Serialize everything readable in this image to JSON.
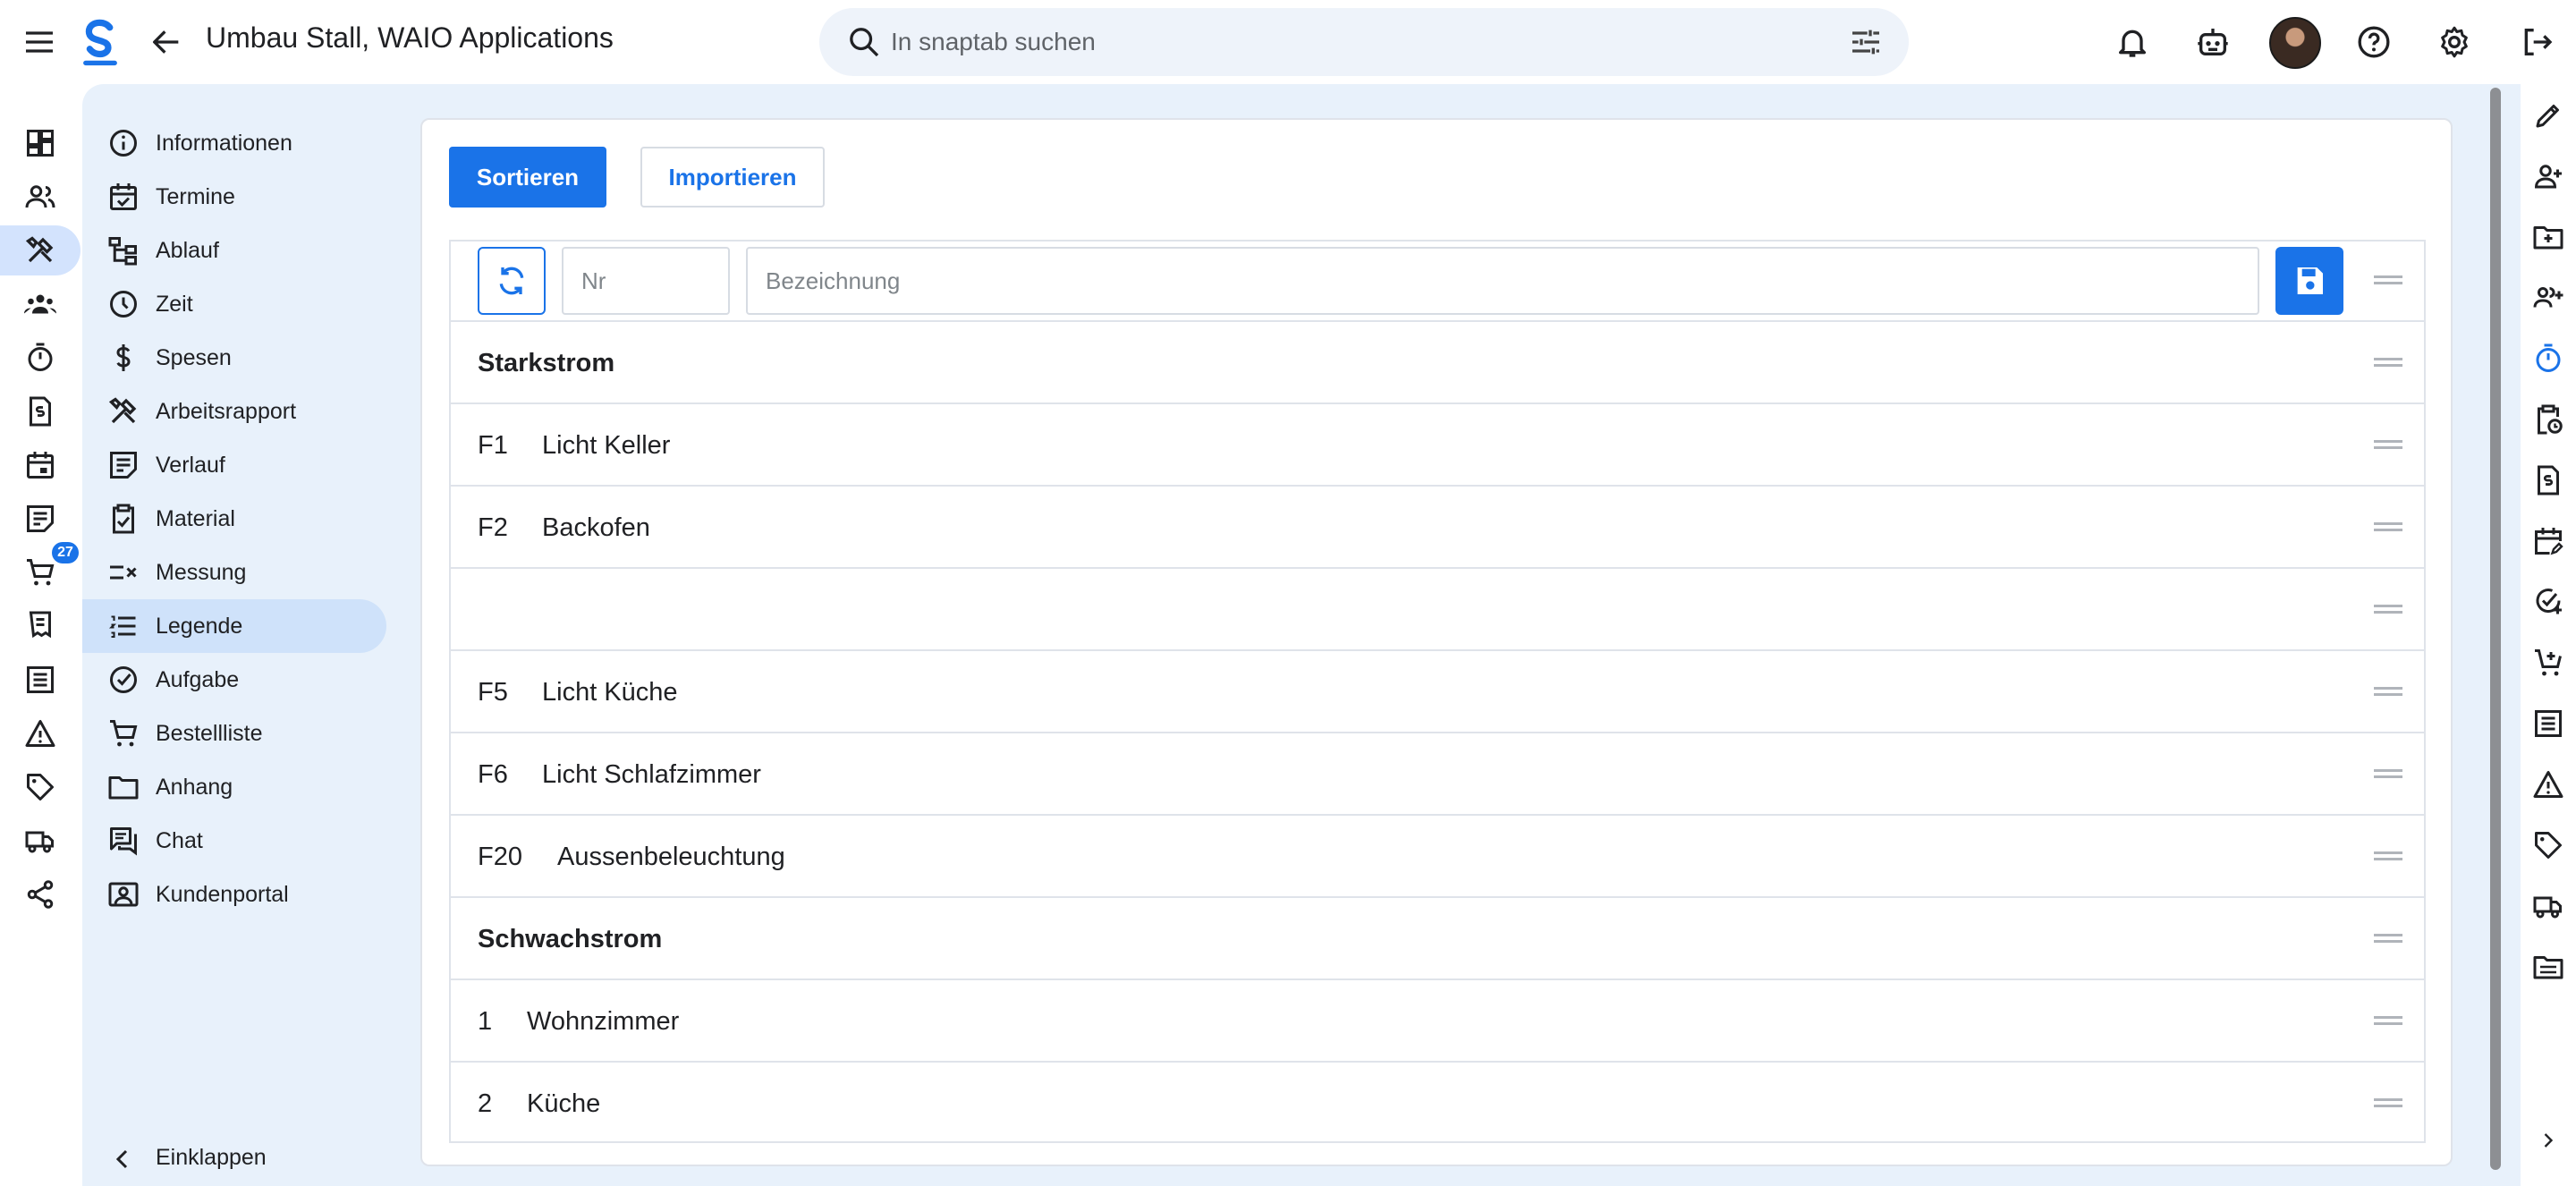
{
  "header": {
    "title": "Umbau Stall, WAIO Applications",
    "search_placeholder": "In snaptab suchen"
  },
  "rail": {
    "cart_badge": "27"
  },
  "subnav": {
    "items": [
      {
        "label": "Informationen",
        "icon": "info-icon"
      },
      {
        "label": "Termine",
        "icon": "calendar-check-icon"
      },
      {
        "label": "Ablauf",
        "icon": "flow-tree-icon"
      },
      {
        "label": "Zeit",
        "icon": "clock-icon"
      },
      {
        "label": "Spesen",
        "icon": "dollar-icon"
      },
      {
        "label": "Arbeitsrapport",
        "icon": "tools-icon"
      },
      {
        "label": "Verlauf",
        "icon": "history-note-icon"
      },
      {
        "label": "Material",
        "icon": "clipboard-check-icon"
      },
      {
        "label": "Messung",
        "icon": "measure-icon"
      },
      {
        "label": "Legende",
        "icon": "list-icon"
      },
      {
        "label": "Aufgabe",
        "icon": "task-check-icon"
      },
      {
        "label": "Bestellliste",
        "icon": "cart-icon"
      },
      {
        "label": "Anhang",
        "icon": "folder-icon"
      },
      {
        "label": "Chat",
        "icon": "chat-icon"
      },
      {
        "label": "Kundenportal",
        "icon": "portal-icon"
      }
    ],
    "active": "Legende",
    "collapse_label": "Einklappen"
  },
  "toolbar": {
    "sort_label": "Sortieren",
    "import_label": "Importieren"
  },
  "editor": {
    "nr_placeholder": "Nr",
    "bezeichnung_placeholder": "Bezeichnung"
  },
  "rows": [
    {
      "type": "section",
      "nr": "",
      "label": "Starkstrom"
    },
    {
      "type": "item",
      "nr": "F1",
      "label": "Licht Keller"
    },
    {
      "type": "item",
      "nr": "F2",
      "label": "Backofen"
    },
    {
      "type": "item",
      "nr": "",
      "label": ""
    },
    {
      "type": "item",
      "nr": "F5",
      "label": "Licht Küche"
    },
    {
      "type": "item",
      "nr": "F6",
      "label": "Licht Schlafzimmer"
    },
    {
      "type": "item",
      "nr": "F20",
      "label": "Aussenbeleuchtung"
    },
    {
      "type": "section",
      "nr": "",
      "label": "Schwachstrom"
    },
    {
      "type": "item",
      "nr": "1",
      "label": "Wohnzimmer"
    },
    {
      "type": "item",
      "nr": "2",
      "label": "Küche"
    }
  ],
  "colors": {
    "accent": "#1a73e8",
    "background": "#e8f1fb",
    "active_nav": "#cfe2fa"
  }
}
